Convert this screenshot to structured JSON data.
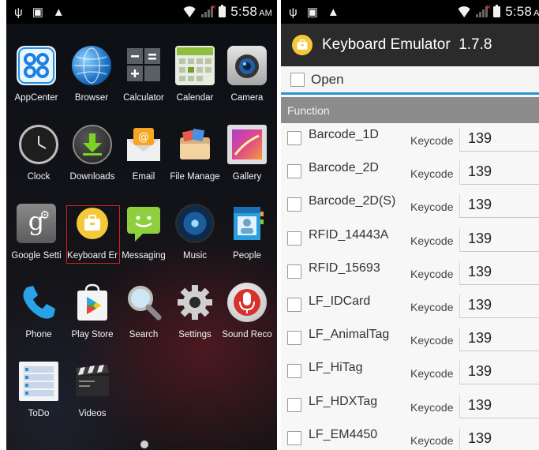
{
  "left_screen": {
    "status": {
      "time": "5:58",
      "ampm": "AM"
    },
    "apps": [
      {
        "label": "AppCenter",
        "icon": "appcenter-icon"
      },
      {
        "label": "Browser",
        "icon": "globe-icon"
      },
      {
        "label": "Calculator",
        "icon": "calculator-icon"
      },
      {
        "label": "Calendar",
        "icon": "calendar-icon"
      },
      {
        "label": "Camera",
        "icon": "camera-icon"
      },
      {
        "label": "Clock",
        "icon": "clock-icon"
      },
      {
        "label": "Downloads",
        "icon": "download-icon"
      },
      {
        "label": "Email",
        "icon": "email-icon"
      },
      {
        "label": "File Manage",
        "icon": "file-manager-icon"
      },
      {
        "label": "Gallery",
        "icon": "gallery-icon"
      },
      {
        "label": "Google Setti",
        "icon": "google-settings-icon"
      },
      {
        "label": "Keyboard Er",
        "icon": "keyboard-emulator-icon"
      },
      {
        "label": "Messaging",
        "icon": "messaging-icon"
      },
      {
        "label": "Music",
        "icon": "music-icon"
      },
      {
        "label": "People",
        "icon": "people-icon"
      },
      {
        "label": "Phone",
        "icon": "phone-icon"
      },
      {
        "label": "Play Store",
        "icon": "play-store-icon"
      },
      {
        "label": "Search",
        "icon": "search-icon"
      },
      {
        "label": "Settings",
        "icon": "settings-icon"
      },
      {
        "label": "Sound Reco",
        "icon": "microphone-icon"
      },
      {
        "label": "ToDo",
        "icon": "todo-icon"
      },
      {
        "label": "Videos",
        "icon": "clapperboard-icon"
      }
    ],
    "highlight_color": "#d52020"
  },
  "right_screen": {
    "status": {
      "time": "5:58",
      "ampm": "AM"
    },
    "app_title": "Keyboard Emulator  1.7.8",
    "open_label": "Open",
    "section_label": "Function",
    "keycode_label": "Keycode",
    "functions": [
      {
        "name": "Barcode_1D",
        "keycode": "139"
      },
      {
        "name": "Barcode_2D",
        "keycode": "139"
      },
      {
        "name": "Barcode_2D(S)",
        "keycode": "139"
      },
      {
        "name": "RFID_14443A",
        "keycode": "139"
      },
      {
        "name": "RFID_15693",
        "keycode": "139"
      },
      {
        "name": "LF_IDCard",
        "keycode": "139"
      },
      {
        "name": "LF_AnimalTag",
        "keycode": "139"
      },
      {
        "name": "LF_HiTag",
        "keycode": "139"
      },
      {
        "name": "LF_HDXTag",
        "keycode": "139"
      },
      {
        "name": "LF_EM4450",
        "keycode": "139"
      }
    ],
    "accent_color": "#2d8fd0"
  }
}
